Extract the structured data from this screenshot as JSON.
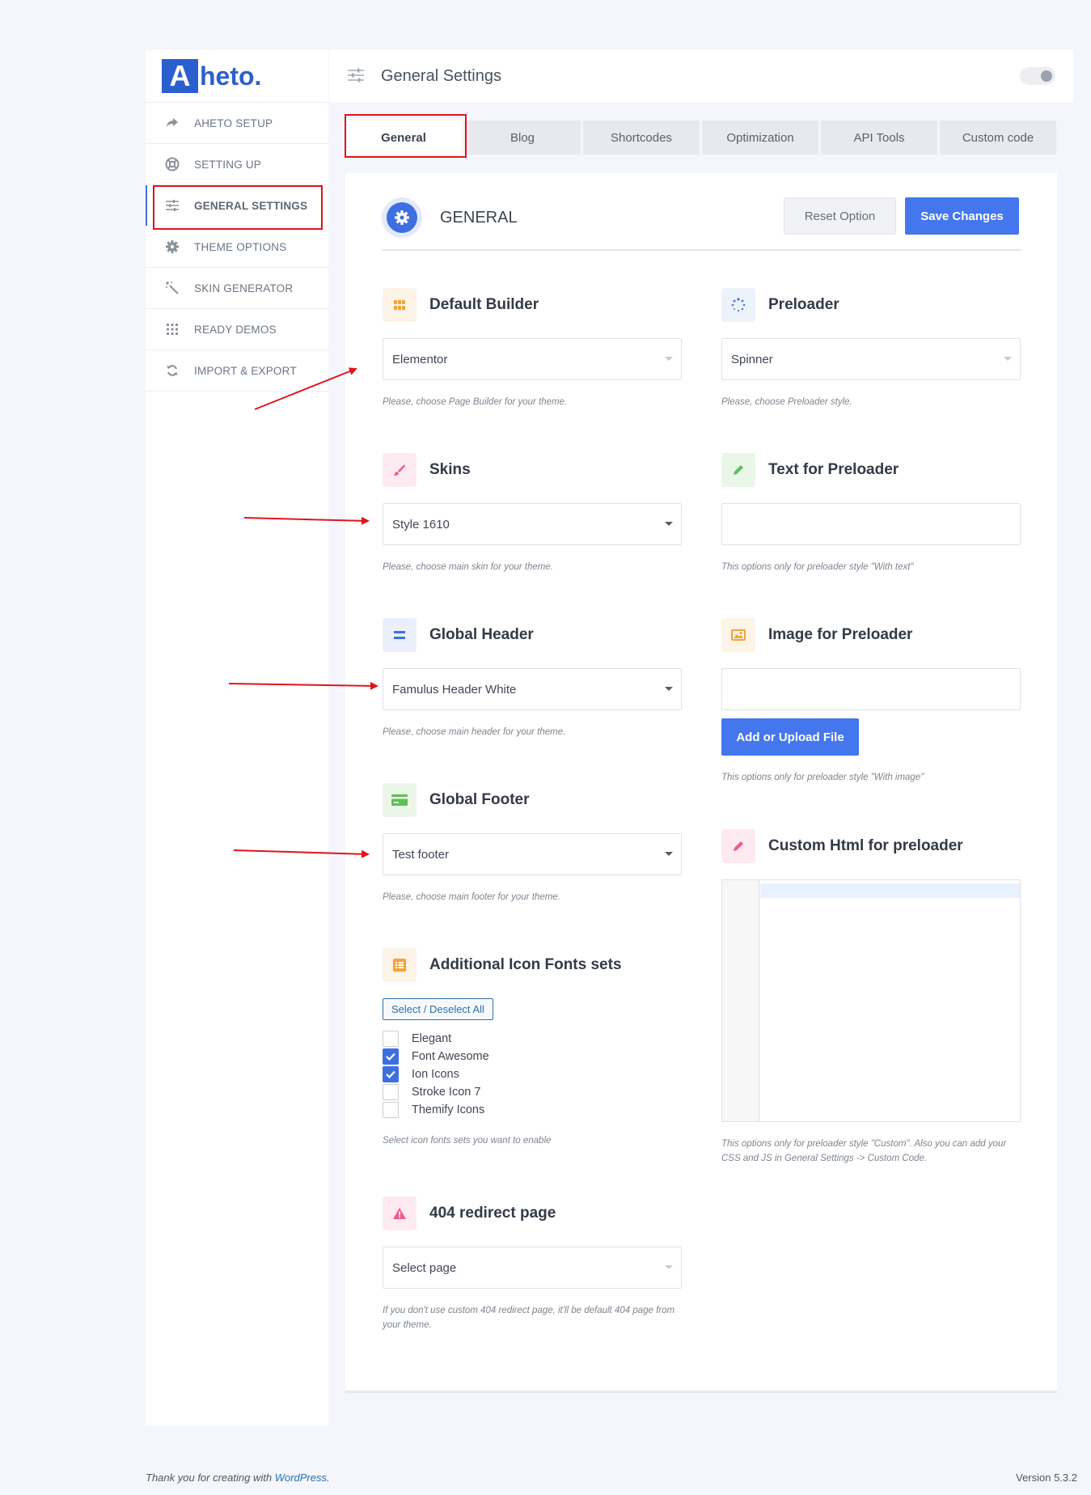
{
  "logo": {
    "letter": "A",
    "text": "heto."
  },
  "sidebar": {
    "items": [
      {
        "label": "AHETO SETUP",
        "icon": "share-arrow-icon"
      },
      {
        "label": "SETTING UP",
        "icon": "lifebuoy-icon"
      },
      {
        "label": "GENERAL SETTINGS",
        "icon": "sliders-icon"
      },
      {
        "label": "THEME OPTIONS",
        "icon": "gear-icon"
      },
      {
        "label": "SKIN GENERATOR",
        "icon": "magic-wand-icon"
      },
      {
        "label": "READY DEMOS",
        "icon": "grid-dots-icon"
      },
      {
        "label": "IMPORT & EXPORT",
        "icon": "refresh-icon"
      }
    ]
  },
  "header": {
    "title": "General Settings"
  },
  "tabs": [
    "General",
    "Blog",
    "Shortcodes",
    "Optimization",
    "API Tools",
    "Custom code"
  ],
  "section": {
    "title": "GENERAL",
    "reset_label": "Reset Option",
    "save_label": "Save Changes"
  },
  "fields": {
    "default_builder": {
      "title": "Default Builder",
      "value": "Elementor",
      "help": "Please, choose Page Builder for your theme."
    },
    "preloader": {
      "title": "Preloader",
      "value": "Spinner",
      "help": "Please, choose Preloader style."
    },
    "skins": {
      "title": "Skins",
      "value": "Style 1610",
      "help": "Please, choose main skin for your theme."
    },
    "text_preloader": {
      "title": "Text for Preloader",
      "value": "",
      "help": "This options only for preloader style \"With text\""
    },
    "global_header": {
      "title": "Global Header",
      "value": "Famulus Header White",
      "help": "Please, choose main header for your theme."
    },
    "image_preloader": {
      "title": "Image for Preloader",
      "value": "",
      "button": "Add or Upload File",
      "help": "This options only for preloader style \"With image\""
    },
    "global_footer": {
      "title": "Global Footer",
      "value": "Test footer",
      "help": "Please, choose main footer for your theme."
    },
    "custom_html": {
      "title": "Custom Html for preloader",
      "help": "This options only for preloader style \"Custom\". Also you can add your CSS and JS in General Settings -> Custom Code."
    },
    "icon_fonts": {
      "title": "Additional Icon Fonts sets",
      "select_all": "Select / Deselect All",
      "options": [
        {
          "label": "Elegant",
          "checked": false
        },
        {
          "label": "Font Awesome",
          "checked": true
        },
        {
          "label": "Ion Icons",
          "checked": true
        },
        {
          "label": "Stroke Icon 7",
          "checked": false
        },
        {
          "label": "Themify Icons",
          "checked": false
        }
      ],
      "help": "Select icon fonts sets you want to enable"
    },
    "redirect_404": {
      "title": "404 redirect page",
      "value": "Select page",
      "help": "If you don't use custom 404 redirect page, it'll be default 404 page from your theme."
    }
  },
  "footer": {
    "thanks_prefix": "Thank you for creating with ",
    "link": "WordPress",
    "thanks_suffix": ".",
    "version": "Version 5.3.2"
  },
  "colors": {
    "accent": "#4477ee",
    "annotation_red": "#e0141c"
  }
}
